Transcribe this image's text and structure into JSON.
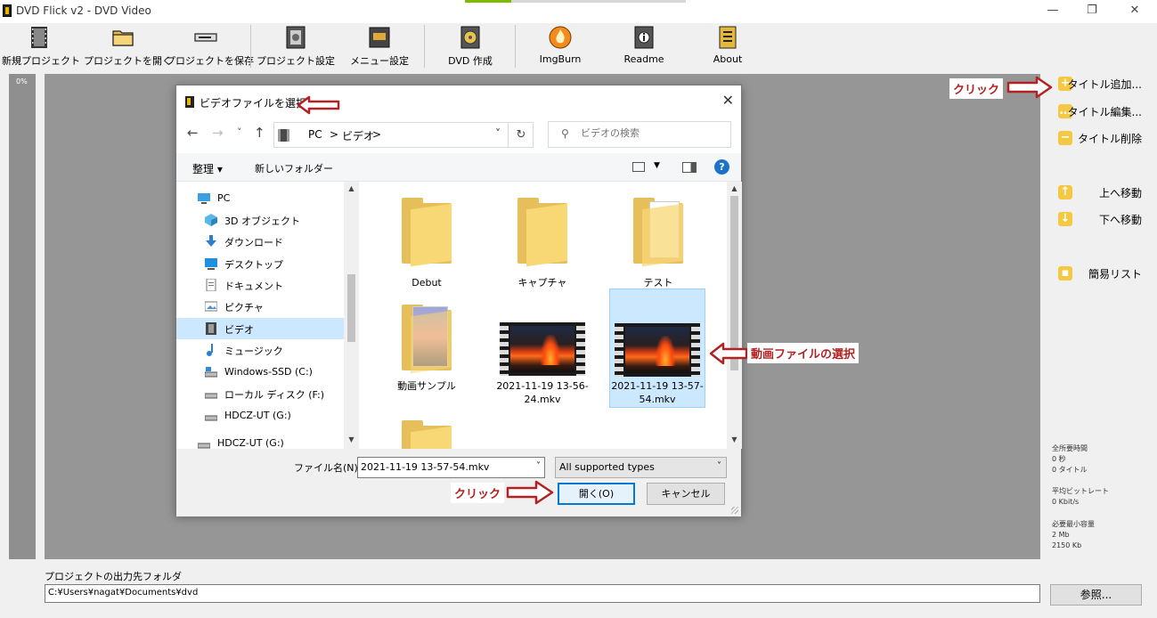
{
  "window": {
    "title": "DVD Flick v2 - DVD Video",
    "minimize": "—",
    "maximize": "❐",
    "close": "✕"
  },
  "toolbar": {
    "buttons": [
      {
        "label": "新規プロジェクト",
        "icon": "film-icon"
      },
      {
        "label": "プロジェクトを開く",
        "icon": "folder-icon"
      },
      {
        "label": "プロジェクトを保存",
        "icon": "disc-drive-icon"
      },
      {
        "label": "プロジェクト設定",
        "icon": "project-settings-icon"
      },
      {
        "label": "メニュー設定",
        "icon": "menu-settings-icon"
      },
      {
        "label": "DVD 作成",
        "icon": "dvd-create-icon"
      },
      {
        "label": "ImgBurn",
        "icon": "imgburn-flame-icon"
      },
      {
        "label": "Readme",
        "icon": "readme-icon"
      },
      {
        "label": "About",
        "icon": "about-icon"
      }
    ]
  },
  "progress": {
    "label": "0%",
    "value": 0
  },
  "right_panel": {
    "buttons": [
      {
        "label": "タイトル追加...",
        "icon": "plus-icon",
        "glyph": "+"
      },
      {
        "label": "タイトル編集...",
        "icon": "ellipsis-icon",
        "glyph": "…"
      },
      {
        "label": "タイトル削除",
        "icon": "minus-icon",
        "glyph": "−"
      },
      {
        "label": "上へ移動",
        "icon": "arrow-up-icon",
        "glyph": "↑"
      },
      {
        "label": "下へ移動",
        "icon": "arrow-down-icon",
        "glyph": "↓"
      },
      {
        "label": "簡易リスト",
        "icon": "list-icon",
        "glyph": "▪"
      }
    ],
    "stats": {
      "total_time_label": "全所要時間",
      "total_time_value": "0 秒",
      "titles_value": "0 タイトル",
      "bitrate_label": "平均ビットレート",
      "bitrate_value": "0 Kbit/s",
      "size_label": "必要最小容量",
      "size_mb": "2 Mb",
      "size_kb": "2150 Kb"
    }
  },
  "output": {
    "label": "プロジェクトの出力先フォルダ",
    "path": "C:¥Users¥nagat¥Documents¥dvd",
    "browse": "参照..."
  },
  "dialog": {
    "title": "ビデオファイルを選択",
    "close": "✕",
    "nav": {
      "back": "←",
      "forward": "→",
      "recent": "˅",
      "up": "↑",
      "refresh": "↻"
    },
    "address": {
      "crumbs": [
        "PC",
        ">",
        "ビデオ",
        ">"
      ],
      "dropdown": "˅"
    },
    "search_placeholder": "ビデオの検索",
    "commands": {
      "organize": "整理 ▾",
      "new_folder": "新しいフォルダー",
      "help": "?"
    },
    "nav_pane": [
      {
        "label": "PC",
        "icon": "pc-icon"
      },
      {
        "label": "3D オブジェクト",
        "icon": "3d-objects-icon"
      },
      {
        "label": "ダウンロード",
        "icon": "download-icon"
      },
      {
        "label": "デスクトップ",
        "icon": "desktop-icon"
      },
      {
        "label": "ドキュメント",
        "icon": "documents-icon"
      },
      {
        "label": "ピクチャ",
        "icon": "pictures-icon"
      },
      {
        "label": "ビデオ",
        "icon": "videos-icon",
        "selected": true
      },
      {
        "label": "ミュージック",
        "icon": "music-icon"
      },
      {
        "label": "Windows-SSD (C:)",
        "icon": "drive-icon"
      },
      {
        "label": "ローカル ディスク (F:)",
        "icon": "drive-icon"
      },
      {
        "label": "HDCZ-UT (G:)",
        "icon": "drive-icon"
      },
      {
        "label": "HDCZ-UT (G:)",
        "icon": "drive-icon"
      }
    ],
    "files": [
      {
        "name": "Debut",
        "kind": "folder"
      },
      {
        "name": "キャプチャ",
        "kind": "folder"
      },
      {
        "name": "テスト",
        "kind": "folder-doc"
      },
      {
        "name": "動画サンプル",
        "kind": "folder-pictures"
      },
      {
        "name": "2021-11-19 13-56-24.mkv",
        "kind": "video"
      },
      {
        "name": "2021-11-19 13-57-54.mkv",
        "kind": "video",
        "selected": true
      }
    ],
    "filename_label": "ファイル名(N):",
    "filename_value": "2021-11-19 13-57-54.mkv",
    "filetype_value": "All supported types",
    "open_button": "開く(O)",
    "cancel_button": "キャンセル"
  },
  "annotations": {
    "click_add": "クリック",
    "click_open": "クリック",
    "select_video": "動画ファイルの選択"
  },
  "colors": {
    "annotation_red": "#b22222",
    "accent_blue": "#0078d7",
    "selection": "#cce8ff",
    "panel_icon_yellow": "#f4c842"
  }
}
